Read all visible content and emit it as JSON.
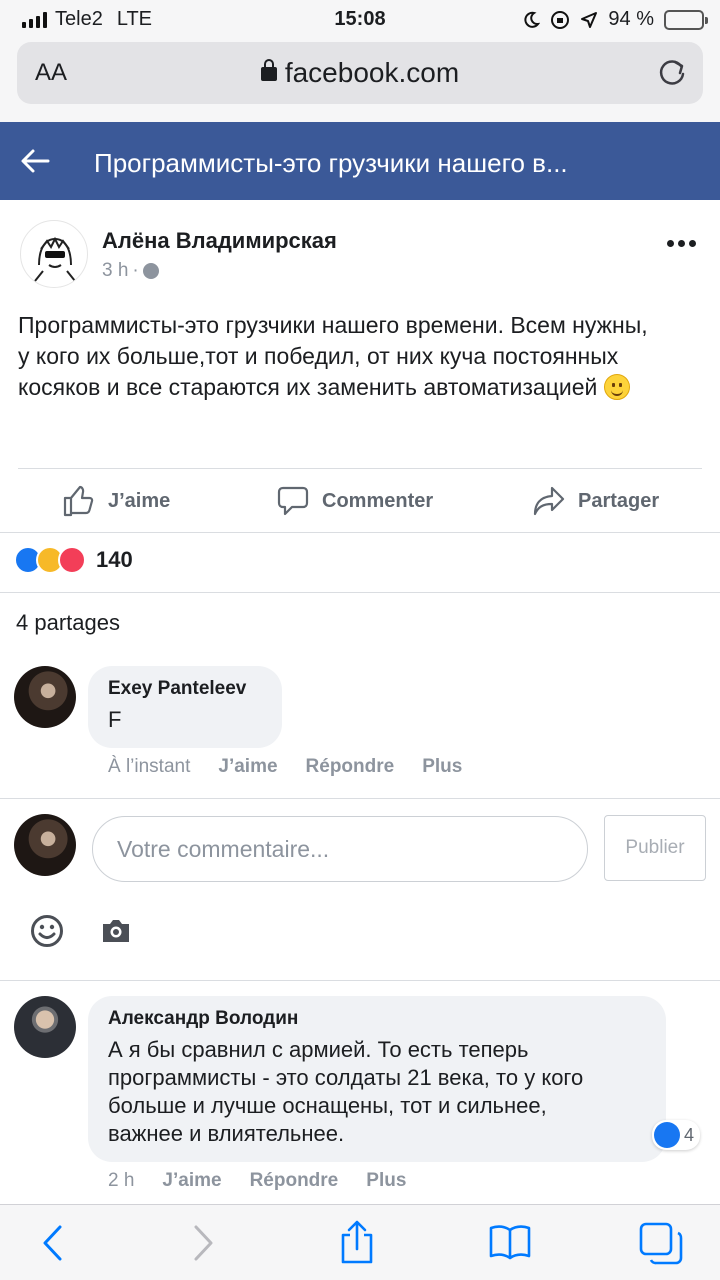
{
  "status_bar": {
    "carrier": "Tele2",
    "network": "LTE",
    "time": "15:08",
    "battery": "94 %",
    "battery_level": 0.94
  },
  "browser": {
    "text_size_label": "AA",
    "domain": "facebook.com"
  },
  "header": {
    "title": "Программисты-это грузчики нашего в..."
  },
  "post": {
    "author": "Алёна Владимирская",
    "time": "3 h",
    "separator": "·",
    "text": "Программисты-это грузчики нашего времени. Всем нужны, у кого их больше,тот и победил, от них куча постоянных косяков и все стараются их заменить автоматизацией",
    "actions": {
      "like": "J’aime",
      "comment": "Commenter",
      "share": "Partager"
    },
    "reactions_count": "140",
    "shares": "4 partages"
  },
  "comments": [
    {
      "author": "Exey Panteleev",
      "text": "F",
      "time": "À l’instant",
      "like": "J’aime",
      "reply": "Répondre",
      "more": "Plus"
    },
    {
      "author": "Александр Володин",
      "text": "А я бы сравнил с армией. То есть теперь программисты - это солдаты 21 века, то у кого больше и лучше оснащены, тот и сильнее, важнее и влиятельнее.",
      "time": "2 h",
      "like": "J’aime",
      "reply": "Répondre",
      "more": "Plus",
      "likes": "4"
    }
  ],
  "composer": {
    "placeholder": "Votre commentaire...",
    "publish": "Publier"
  },
  "colors": {
    "facebook_blue": "#3b5998",
    "ios_blue": "#007aff",
    "like_blue": "#1877f2"
  },
  "icons": [
    "signal-icon",
    "moon-icon",
    "orientation-lock-icon",
    "location-icon",
    "battery-icon",
    "lock-icon",
    "reload-icon",
    "back-arrow-icon",
    "globe-icon",
    "more-icon",
    "like-icon",
    "comment-icon",
    "share-icon",
    "emoji-icon",
    "camera-icon",
    "browser-back-icon",
    "browser-forward-icon",
    "share-sheet-icon",
    "bookmarks-icon",
    "tabs-icon"
  ]
}
